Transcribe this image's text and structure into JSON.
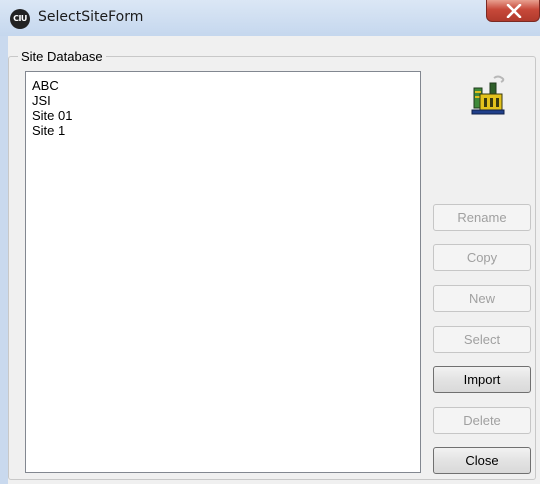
{
  "window": {
    "title": "SelectSiteForm",
    "icon_label": "CIU",
    "icon": "app-icon",
    "close_icon": "close-x-icon"
  },
  "group": {
    "label": "Site Database"
  },
  "list": {
    "items": [
      "ABC",
      "JSI",
      "Site 01",
      "Site 1"
    ]
  },
  "site_icon": "factory-icon",
  "buttons": {
    "rename": "Rename",
    "copy": "Copy",
    "new": "New",
    "select": "Select",
    "import": "Import",
    "delete": "Delete",
    "close": "Close"
  },
  "colors": {
    "close_button": "#c7493a",
    "titlebar": "#c5d7ee",
    "disabled_text": "#a0a0a0"
  }
}
